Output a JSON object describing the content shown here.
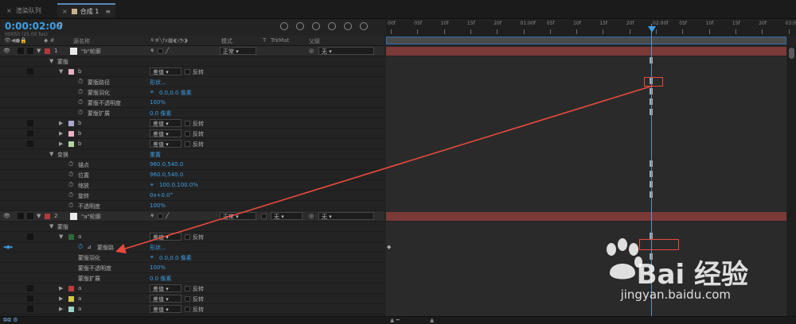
{
  "tabs": [
    {
      "label": "渲染队列",
      "active": false
    },
    {
      "label": "合成 1",
      "active": true
    }
  ],
  "timecode": "0:00:02:00",
  "fps": "00050 (25.00 fps)",
  "search_icon": "search-icon",
  "columns": {
    "name": "源名称",
    "mode": "模式",
    "trk_t": "T",
    "trkmat": "TrkMat",
    "parent": "父级"
  },
  "layers": [
    {
      "num": "1",
      "name": "\"b\"轮廓",
      "mode": "正常",
      "parent": "无",
      "color": "#b03a3a"
    },
    {
      "num": "2",
      "name": "\"a\"轮廓",
      "mode": "正常",
      "trkmat": "无",
      "parent": "无",
      "color": "#b03a3a"
    }
  ],
  "labels": {
    "masks": "蒙版",
    "mask_b": "b",
    "mask_a": "a",
    "mask_path": "蒙版路径",
    "mask_path_short": "蒙版路",
    "mask_feather": "蒙版羽化",
    "mask_opacity": "蒙版不透明度",
    "mask_expansion": "蒙版扩展",
    "transform": "变换",
    "anchor": "锚点",
    "position": "位置",
    "scale": "缩放",
    "rotation": "旋转",
    "opacity": "不透明度",
    "diff": "差值",
    "invert": "反转",
    "shape": "形状...",
    "feather_val": "0.0,0.0 像素",
    "opacity_val": "100%",
    "expansion_val": "0.0 像素",
    "reset": "重置",
    "anchor_val": "960.0,540.0",
    "position_val": "960.0,540.0",
    "scale_val": "100.0,100.0%",
    "rotation_val": "0x+0.0°",
    "sub_b": "b",
    "sub_a": "a"
  },
  "ruler_ticks": [
    "00f",
    "05f",
    "10f",
    "15f",
    "20f",
    "01:00f",
    "05f",
    "10f",
    "15f",
    "20f",
    "02:00f",
    "05f",
    "10f",
    "15f",
    "20f",
    "03:00"
  ],
  "watermark": {
    "main": "Bai  经验",
    "sub": "jingyan.baidu.com"
  },
  "colors": {
    "accent": "#3ea0e6",
    "layer_bar": "#7b3a38",
    "annotation": "#e84a3e"
  }
}
